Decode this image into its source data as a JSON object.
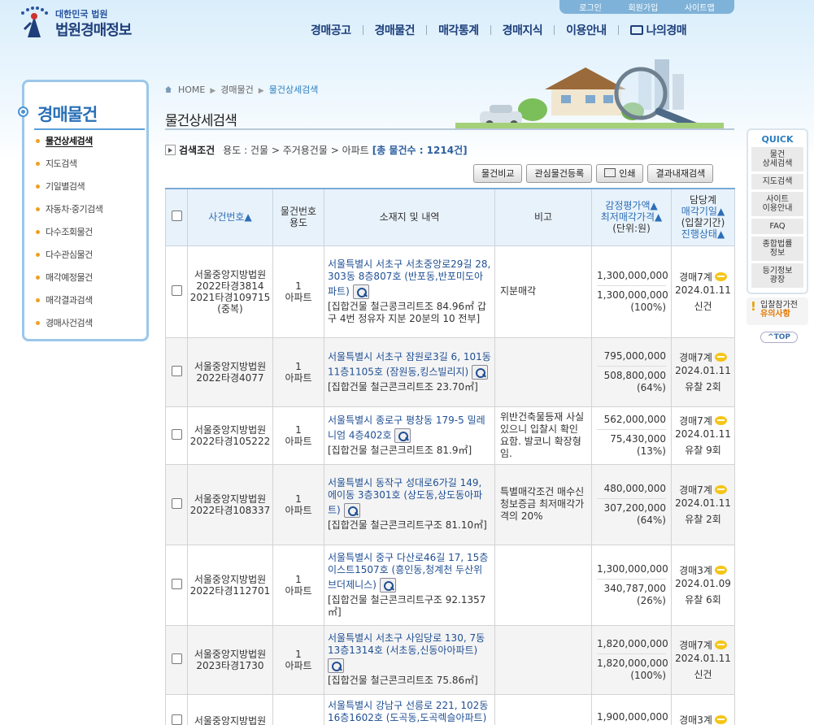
{
  "header": {
    "logo_top": "대한민국 법원",
    "logo_main": "법원경매정보",
    "util_links": [
      "로그인",
      "회원가입",
      "사이트맵"
    ],
    "gnb": [
      "경매공고",
      "경매물건",
      "매각통계",
      "경매지식",
      "이용안내",
      "나의경매"
    ]
  },
  "sidebar": {
    "title": "경매물건",
    "items": [
      {
        "label": "물건상세검색"
      },
      {
        "label": "지도검색"
      },
      {
        "label": "기일별검색"
      },
      {
        "label": "자동차·중기검색"
      },
      {
        "label": "다수조회물건"
      },
      {
        "label": "다수관심물건"
      },
      {
        "label": "매각예정물건"
      },
      {
        "label": "매각결과검색"
      },
      {
        "label": "경매사건검색"
      }
    ]
  },
  "breadcrumb": {
    "home": "HOME",
    "b1": "경매물건",
    "b2": "물건상세검색"
  },
  "page_title": "물건상세검색",
  "conditions": {
    "label": "검색조건",
    "value": "용도 : 건물 > 주거용건물 > 아파트",
    "count": "[총 물건수 : 1214건]"
  },
  "buttons": {
    "compare": "물건비교",
    "favorite": "관심물건등록",
    "print": "인쇄",
    "result_search": "결과내재검색"
  },
  "table": {
    "headers": {
      "case": "사건번호▲",
      "itemno_1": "물건번호",
      "itemno_2": "용도",
      "location": "소재지 및 내역",
      "note": "비고",
      "price_1": "감정평가액▲",
      "price_2": "최저매각가격▲",
      "price_3": "(단위:원)",
      "dept_1": "담당계",
      "dept_2": "매각기일▲",
      "dept_3": "(입찰기간)",
      "dept_4": "진행상태▲"
    },
    "rows": [
      {
        "court": "서울중앙지방법원",
        "case": "2022타경3814",
        "case2": "2021타경109715",
        "case3": "(중복)",
        "item": "1",
        "use": "아파트",
        "addr": "서울특별시 서초구 서초중앙로29길 28, 303동 8층807호 (반포동,반포미도아파트)",
        "detail": "[집합건물 철근콩크리트조 84.96㎡ 갑구 4번 정유자 지분 20분의 10 전부]",
        "note": "지분매각",
        "appraisal": "1,300,000,000",
        "minimum": "1,300,000,000",
        "pct": "(100%)",
        "dept": "경매7계",
        "date": "2024.01.11",
        "status": "신건"
      },
      {
        "court": "서울중앙지방법원",
        "case": "2022타경4077",
        "case2": "",
        "case3": "",
        "item": "1",
        "use": "아파트",
        "addr": "서울특별시 서초구 잠원로3길 6, 101동 11층1105호 (잠원동,킹스빌리지)",
        "detail": "[집합건물 철근콘크리트조 23.70㎡]",
        "note": "",
        "appraisal": "795,000,000",
        "minimum": "508,800,000",
        "pct": "(64%)",
        "dept": "경매7계",
        "date": "2024.01.11",
        "status": "유찰 2회"
      },
      {
        "court": "서울중앙지방법원",
        "case": "2022타경105222",
        "case2": "",
        "case3": "",
        "item": "1",
        "use": "아파트",
        "addr": "서울특별시 종로구 평창동 179-5 밀레니엄 4층402호",
        "detail": "[집합건물 철근콘크리트조 81.9㎡]",
        "note": "위반건축물등재 사실있으니 입찰시 확인요함. 발코니 확장형임.",
        "appraisal": "562,000,000",
        "minimum": "75,430,000",
        "pct": "(13%)",
        "dept": "경매7계",
        "date": "2024.01.11",
        "status": "유찰 9회"
      },
      {
        "court": "서울중앙지방법원",
        "case": "2022타경108337",
        "case2": "",
        "case3": "",
        "item": "1",
        "use": "아파트",
        "addr": "서울특별시 동작구 성대로6가길 149, 에이동 3층301호 (상도동,상도동아파트)",
        "detail": "[집합건물 철근콘크리트구조 81.10㎡]",
        "note": "특별매각조건 매수신청보증금 최저매각가격의 20%",
        "appraisal": "480,000,000",
        "minimum": "307,200,000",
        "pct": "(64%)",
        "dept": "경매7계",
        "date": "2024.01.11",
        "status": "유찰 2회"
      },
      {
        "court": "서울중앙지방법원",
        "case": "2022타경112701",
        "case2": "",
        "case3": "",
        "item": "1",
        "use": "아파트",
        "addr": "서울특별시 중구 다산로46길 17, 15층이스트1507호 (흥인동,청계천 두산위브더제니스)",
        "detail": "[집합건물 철근콘크리트구조 92.1357㎡]",
        "note": "",
        "appraisal": "1,300,000,000",
        "minimum": "340,787,000",
        "pct": "(26%)",
        "dept": "경매3계",
        "date": "2024.01.09",
        "status": "유찰 6회"
      },
      {
        "court": "서울중앙지방법원",
        "case": "2023타경1730",
        "case2": "",
        "case3": "",
        "item": "1",
        "use": "아파트",
        "addr": "서울특별시 서초구 사임당로 130, 7동 13층1314호 (서초동,신동아아파트)",
        "detail": "[집합건물 철근콘크리트조 75.86㎡]",
        "note": "",
        "appraisal": "1,820,000,000",
        "minimum": "1,820,000,000",
        "pct": "(100%)",
        "dept": "경매7계",
        "date": "2024.01.11",
        "status": "신건"
      },
      {
        "court": "서울중앙지방법원",
        "case": "",
        "case2": "",
        "case3": "",
        "item": "",
        "use": "",
        "addr": "서울특별시 강남구 선릉로 221, 102동 16층1602호 (도곡동,도곡렉슬아파트)",
        "detail": "",
        "note": "",
        "appraisal": "1,900,000,000",
        "minimum": "",
        "pct": "",
        "dept": "경매3계",
        "date": "",
        "status": ""
      }
    ]
  },
  "quick": {
    "title": "QUICK",
    "items": [
      "물건\n상세검색",
      "지도검색",
      "사이트\n이용안내",
      "FAQ",
      "종합법률\n정보",
      "등기정보\n광장"
    ]
  },
  "notice": {
    "line1": "입찰참가전",
    "line2": "유의사항"
  },
  "top_label": "TOP",
  "colors": {
    "primary": "#1d3f7b",
    "accent": "#2d7fc0",
    "header_bg": "#e8f2fb",
    "bullet": "#f0a020"
  }
}
